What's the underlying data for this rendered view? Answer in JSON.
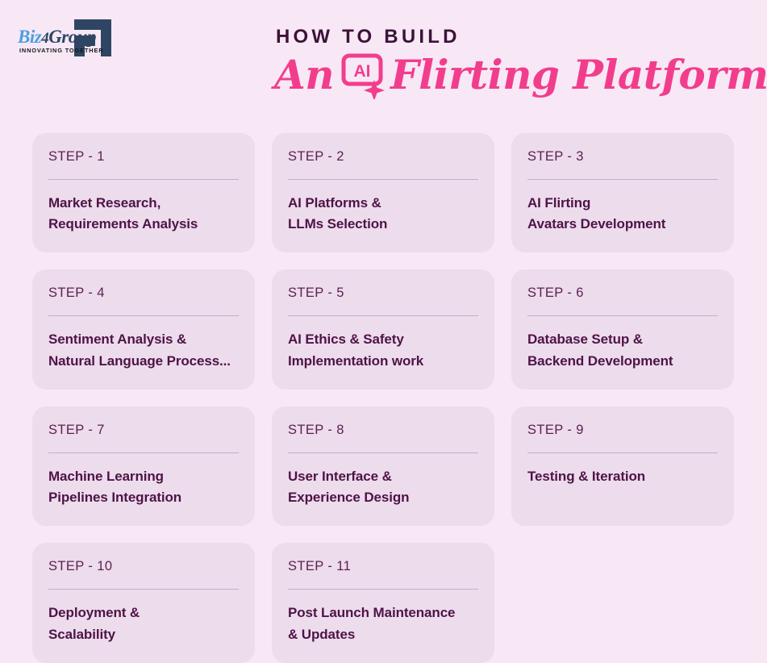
{
  "brand": {
    "logo_biz": "Biz",
    "logo_four": "4",
    "logo_group": "Group",
    "logo_tagline": "INNOVATING TOGETHER",
    "logo_mark_color": "#2e4663",
    "logo_text_accent": "#4a9fe0"
  },
  "header": {
    "kicker": "HOW TO BUILD",
    "script_before": "An",
    "script_after": "Flirting Platform?",
    "ai_badge_label": "AI",
    "kicker_color": "#3c1338",
    "script_color": "#f23d8c"
  },
  "theme": {
    "page_background": "#f8e8f6",
    "card_background": "#eddcec",
    "card_divider": "#c6aec4",
    "step_label_color": "#5c2050",
    "card_title_color": "#4e1347"
  },
  "steps": [
    {
      "label": "STEP - 1",
      "title": "Market Research,\nRequirements Analysis"
    },
    {
      "label": "STEP - 2",
      "title": "AI Platforms &\nLLMs Selection"
    },
    {
      "label": "STEP - 3",
      "title": "AI Flirting\nAvatars Development"
    },
    {
      "label": "STEP - 4",
      "title": "Sentiment Analysis &\nNatural Language Process..."
    },
    {
      "label": "STEP - 5",
      "title": "AI Ethics & Safety\nImplementation work"
    },
    {
      "label": "STEP - 6",
      "title": "Database Setup &\nBackend Development"
    },
    {
      "label": "STEP - 7",
      "title": "Machine Learning\nPipelines Integration"
    },
    {
      "label": "STEP - 8",
      "title": "User Interface &\nExperience Design"
    },
    {
      "label": "STEP - 9",
      "title": "Testing & Iteration"
    },
    {
      "label": "STEP - 10",
      "title": "Deployment &\nScalability"
    },
    {
      "label": "STEP - 11",
      "title": "Post Launch Maintenance\n& Updates"
    }
  ]
}
